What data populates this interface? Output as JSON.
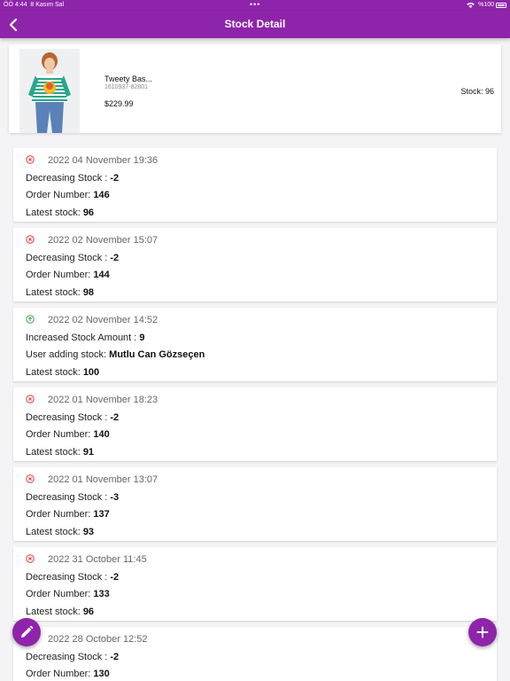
{
  "status_bar": {
    "time": "ÖÖ 4:44",
    "date": "8 Kasım Sal",
    "dots": "•••",
    "battery": "%100"
  },
  "app_bar": {
    "title": "Stock Detail",
    "back_icon": "chevron-left-icon"
  },
  "product": {
    "name": "Tweety Bas...",
    "code": "1610937-82801",
    "price": "$229.99",
    "stock_label": "Stock: 96"
  },
  "entries": [
    {
      "type": "decrease",
      "date": "2022 04 November 19:36",
      "line1_label": "Decreasing Stock : ",
      "line1_value": "-2",
      "line2_label": "Order Number: ",
      "line2_value": "146",
      "line3_label": "Latest stock: ",
      "line3_value": "96"
    },
    {
      "type": "decrease",
      "date": "2022 02 November 15:07",
      "line1_label": "Decreasing Stock : ",
      "line1_value": "-2",
      "line2_label": "Order Number: ",
      "line2_value": "144",
      "line3_label": "Latest stock: ",
      "line3_value": "98"
    },
    {
      "type": "increase",
      "date": "2022 02 November 14:52",
      "line1_label": "Increased Stock Amount : ",
      "line1_value": "9",
      "line2_label": "User adding stock: ",
      "line2_value": "Mutlu Can Gözseçen",
      "line3_label": "Latest stock: ",
      "line3_value": "100"
    },
    {
      "type": "decrease",
      "date": "2022 01 November 18:23",
      "line1_label": "Decreasing Stock : ",
      "line1_value": "-2",
      "line2_label": "Order Number: ",
      "line2_value": "140",
      "line3_label": "Latest stock: ",
      "line3_value": "91"
    },
    {
      "type": "decrease",
      "date": "2022 01 November 13:07",
      "line1_label": "Decreasing Stock : ",
      "line1_value": "-3",
      "line2_label": "Order Number: ",
      "line2_value": "137",
      "line3_label": "Latest stock: ",
      "line3_value": "93"
    },
    {
      "type": "decrease",
      "date": "2022 31 October 11:45",
      "line1_label": "Decreasing Stock : ",
      "line1_value": "-2",
      "line2_label": "Order Number: ",
      "line2_value": "133",
      "line3_label": "Latest stock: ",
      "line3_value": "96"
    },
    {
      "type": "decrease",
      "date": "2022 28 October 12:52",
      "line1_label": "Decreasing Stock : ",
      "line1_value": "-2",
      "line2_label": "Order Number: ",
      "line2_value": "130",
      "line3_label": "",
      "line3_value": ""
    }
  ],
  "fabs": {
    "edit_icon": "pencil-icon",
    "add_icon": "plus-icon"
  },
  "colors": {
    "primary": "#8e24aa",
    "decrease": "#e53935",
    "increase": "#43a047"
  }
}
